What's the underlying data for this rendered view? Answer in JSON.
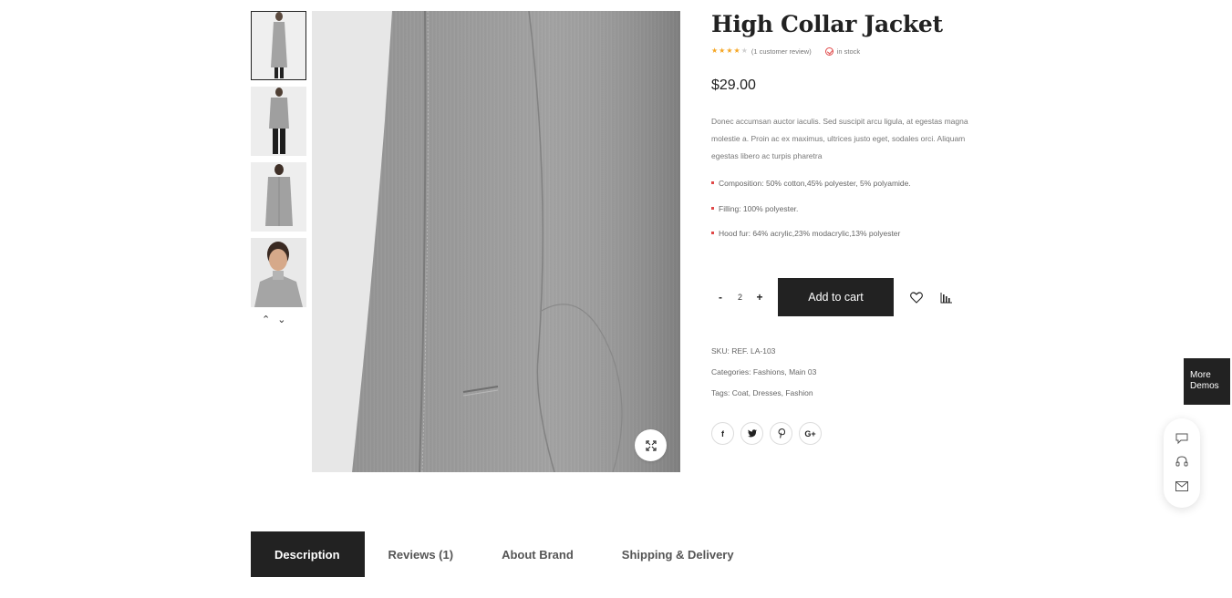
{
  "product": {
    "title": "High Collar Jacket",
    "rating": 4,
    "rating_max": 5,
    "review_count_text": "(1 customer review)",
    "stock_text": "in stock",
    "price": "$29.00",
    "description": "Donec accumsan auctor iaculis. Sed suscipit arcu ligula, at egestas magna molestie a. Proin ac ex maximus, ultrices justo eget, sodales orci. Aliquam egestas libero ac turpis pharetra",
    "features": [
      "Composition: 50% cotton,45% polyester, 5% polyamide.",
      "Filling: 100% polyester.",
      "Hood fur: 64% acrylic,23% modacrylic,13% polyester"
    ]
  },
  "cart": {
    "minus": "-",
    "quantity": "2",
    "plus": "+",
    "add_to_cart": "Add to cart"
  },
  "meta": {
    "sku_label": "SKU:",
    "sku_value": "REF. LA-103",
    "categories_label": "Categories:",
    "categories": [
      "Fashions",
      "Main 03"
    ],
    "tags_label": "Tags:",
    "tags": [
      "Coat",
      "Dresses",
      "Fashion"
    ]
  },
  "share": {
    "facebook": "f",
    "google_plus": "G+"
  },
  "more_demos": {
    "line1": "More",
    "line2": "Demos"
  },
  "tabs": [
    {
      "label": "Description",
      "active": true
    },
    {
      "label": "Reviews (1)",
      "active": false
    },
    {
      "label": "About Brand",
      "active": false
    },
    {
      "label": "Shipping & Delivery",
      "active": false
    }
  ],
  "colors": {
    "dark": "#222222",
    "star": "#f5a623",
    "accent_red": "#e04848",
    "coat_grey": "#9a9a9a"
  },
  "icons": {
    "thumb_up": "chevron-up-icon",
    "thumb_down": "chevron-down-icon",
    "zoom": "expand-icon",
    "wishlist": "heart-icon",
    "compare": "bar-chart-icon",
    "twitter": "twitter-icon",
    "pinterest": "pinterest-icon",
    "float": [
      "chat-icon",
      "headset-icon",
      "mail-icon"
    ]
  }
}
